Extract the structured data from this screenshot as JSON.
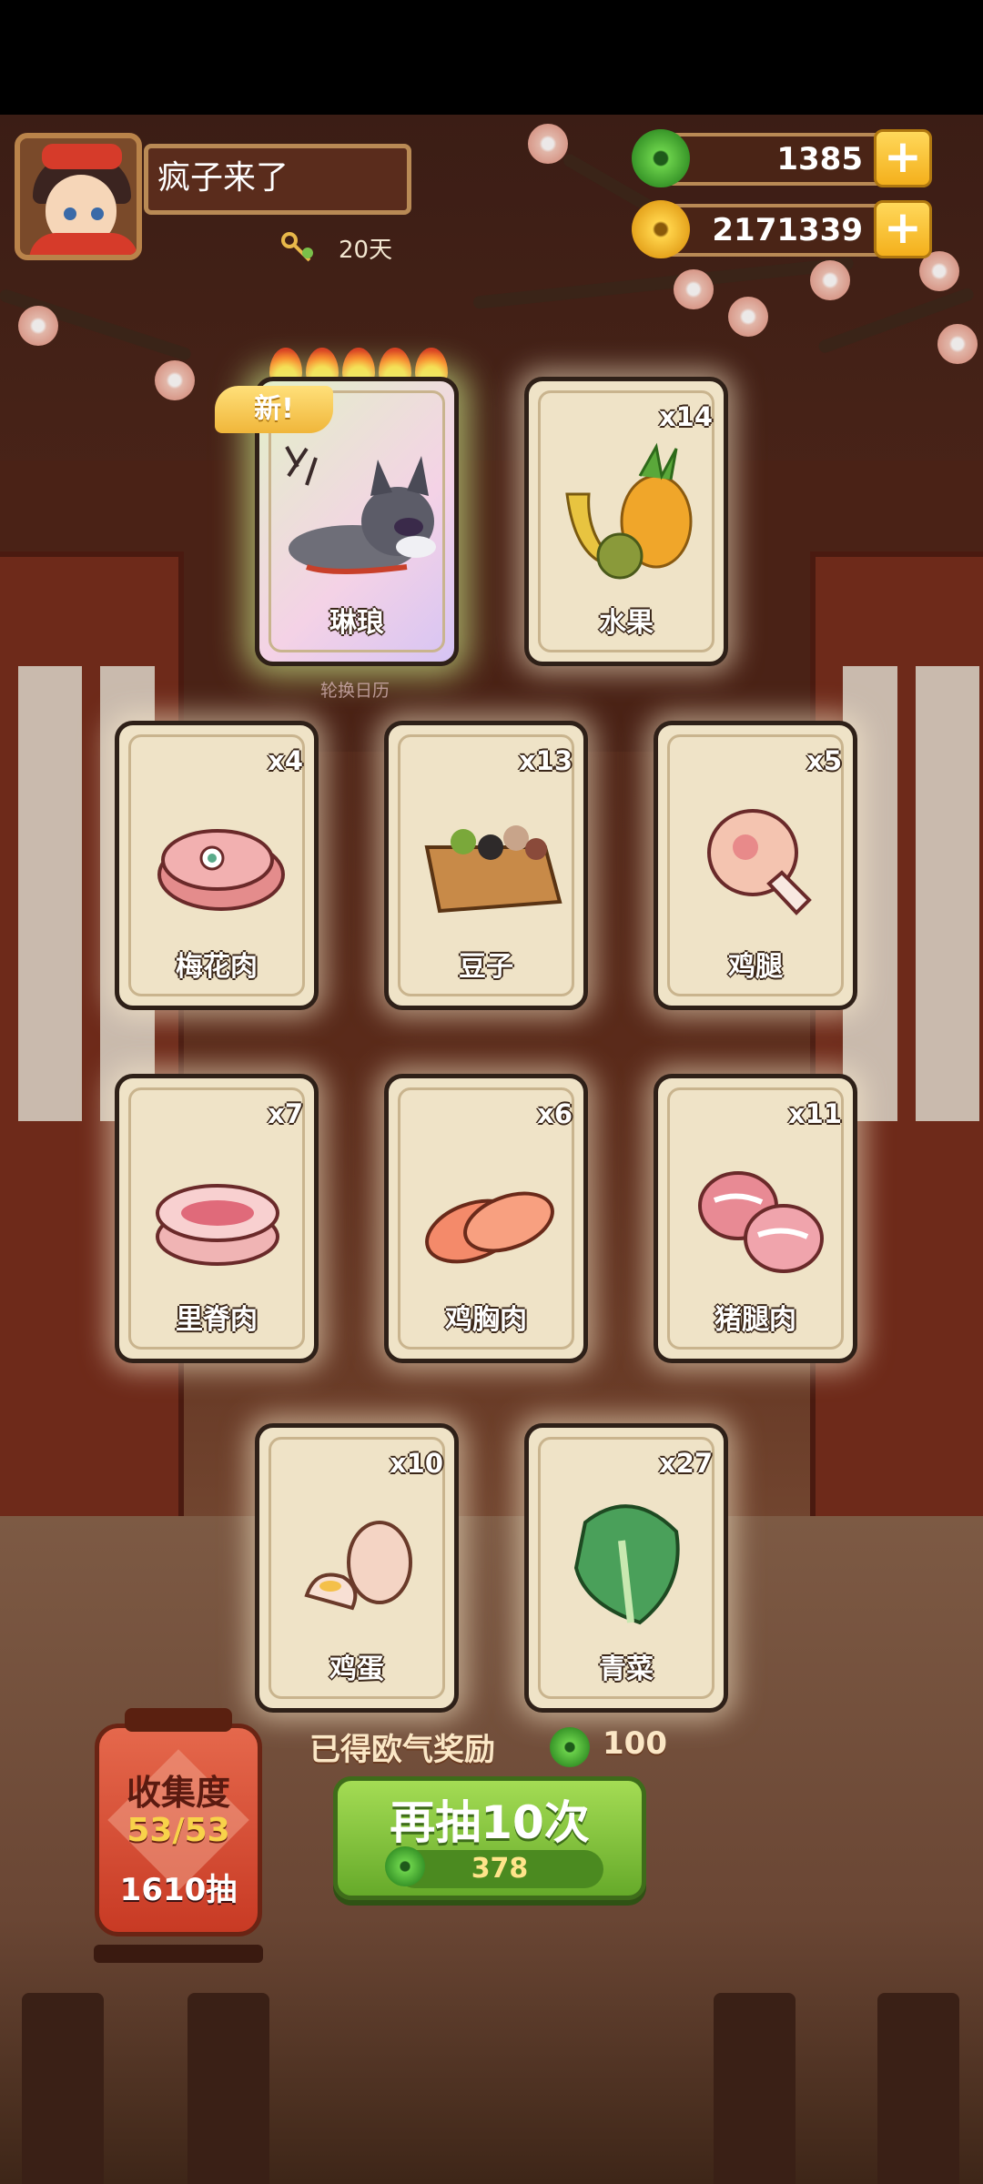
{
  "player": {
    "name": "疯子来了",
    "days": "20天"
  },
  "currencies": {
    "jade": {
      "value": "1385",
      "icon": "jade-coin-icon",
      "color": "#4caf3a"
    },
    "gold": {
      "value": "2171339",
      "icon": "gold-coin-icon",
      "color": "#f2b51c"
    }
  },
  "special_card": {
    "name": "琳琅",
    "badge": "新!",
    "stars": 5,
    "subtitle": "轮换日历"
  },
  "cards": [
    {
      "name": "水果",
      "count": "x14"
    },
    {
      "name": "梅花肉",
      "count": "x4"
    },
    {
      "name": "豆子",
      "count": "x13"
    },
    {
      "name": "鸡腿",
      "count": "x5"
    },
    {
      "name": "里脊肉",
      "count": "x7"
    },
    {
      "name": "鸡胸肉",
      "count": "x6"
    },
    {
      "name": "猪腿肉",
      "count": "x11"
    },
    {
      "name": "鸡蛋",
      "count": "x10"
    },
    {
      "name": "青菜",
      "count": "x27"
    }
  ],
  "reward": {
    "label": "已得欧气奖励",
    "value": "100"
  },
  "draw_button": {
    "label": "再抽10次",
    "cost": "378"
  },
  "collection": {
    "label": "收集度",
    "progress": "53/53",
    "draws": "1610抽"
  },
  "colors": {
    "button_green": "#7cc03a",
    "card_bg": "#efe3c7",
    "lantern_red": "#d94a32"
  }
}
